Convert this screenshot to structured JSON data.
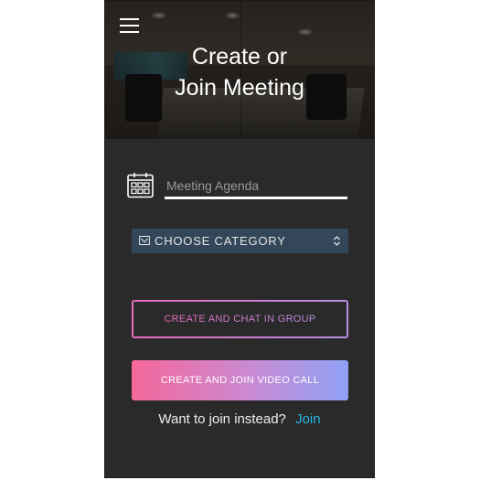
{
  "header": {
    "title_line1": "Create or",
    "title_line2": "Join Meeting"
  },
  "icons": {
    "menu": "menu-icon",
    "calendar": "calendar-icon",
    "category": "category-icon",
    "select_arrows": "updown-chevron-icon"
  },
  "form": {
    "agenda_placeholder": "Meeting Agenda",
    "agenda_value": "",
    "category_label": "CHOOSE CATEGORY"
  },
  "buttons": {
    "create_chat": "CREATE AND CHAT IN GROUP",
    "create_video": "CREATE AND JOIN VIDEO CALL"
  },
  "footer": {
    "join_prompt": "Want to join instead?",
    "join_link": "Join"
  },
  "colors": {
    "background": "#2a2a2a",
    "select_bg": "#34475a",
    "gradient_pink": "#f5679a",
    "gradient_blue": "#8fa1f5",
    "link": "#24b6e0"
  }
}
